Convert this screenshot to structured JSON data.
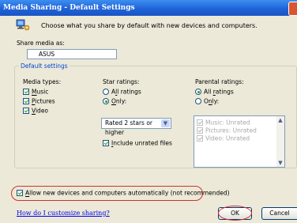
{
  "window": {
    "title": "Media Sharing - Default Settings"
  },
  "header": {
    "description": "Choose what you share by default with new devices and computers."
  },
  "share_name": {
    "label": "Share media as:",
    "value": "ASUS"
  },
  "defaults": {
    "group_label": "Default settings",
    "media_types": {
      "heading": "Media types:",
      "items": [
        {
          "label": "Music",
          "checked": true
        },
        {
          "label": "Pictures",
          "checked": true
        },
        {
          "label": "Video",
          "checked": true
        }
      ]
    },
    "star_ratings": {
      "heading": "Star ratings:",
      "all_label": "All ratings",
      "only_label": "Only:",
      "selected": "Only:",
      "rating_select": "Rated 2 stars or higher",
      "include_unrated": {
        "label": "Include unrated files",
        "checked": true
      }
    },
    "parental_ratings": {
      "heading": "Parental ratings:",
      "all_label": "All ratings",
      "only_label": "Only:",
      "selected": "All ratings",
      "items": [
        {
          "label": "Music: Unrated",
          "checked": true
        },
        {
          "label": "Pictures: Unrated",
          "checked": true
        },
        {
          "label": "Video: Unrated",
          "checked": true
        }
      ]
    }
  },
  "allow_new": {
    "label": "Allow new devices and computers automatically (not recommended)",
    "checked": true
  },
  "footer": {
    "help_link": "How do I customize sharing?",
    "ok_label": "OK",
    "cancel_label": "Cancel"
  },
  "colors": {
    "title_bar": "#1f63d8",
    "highlight_oval": "#d13030",
    "group_label": "#0046d5"
  }
}
